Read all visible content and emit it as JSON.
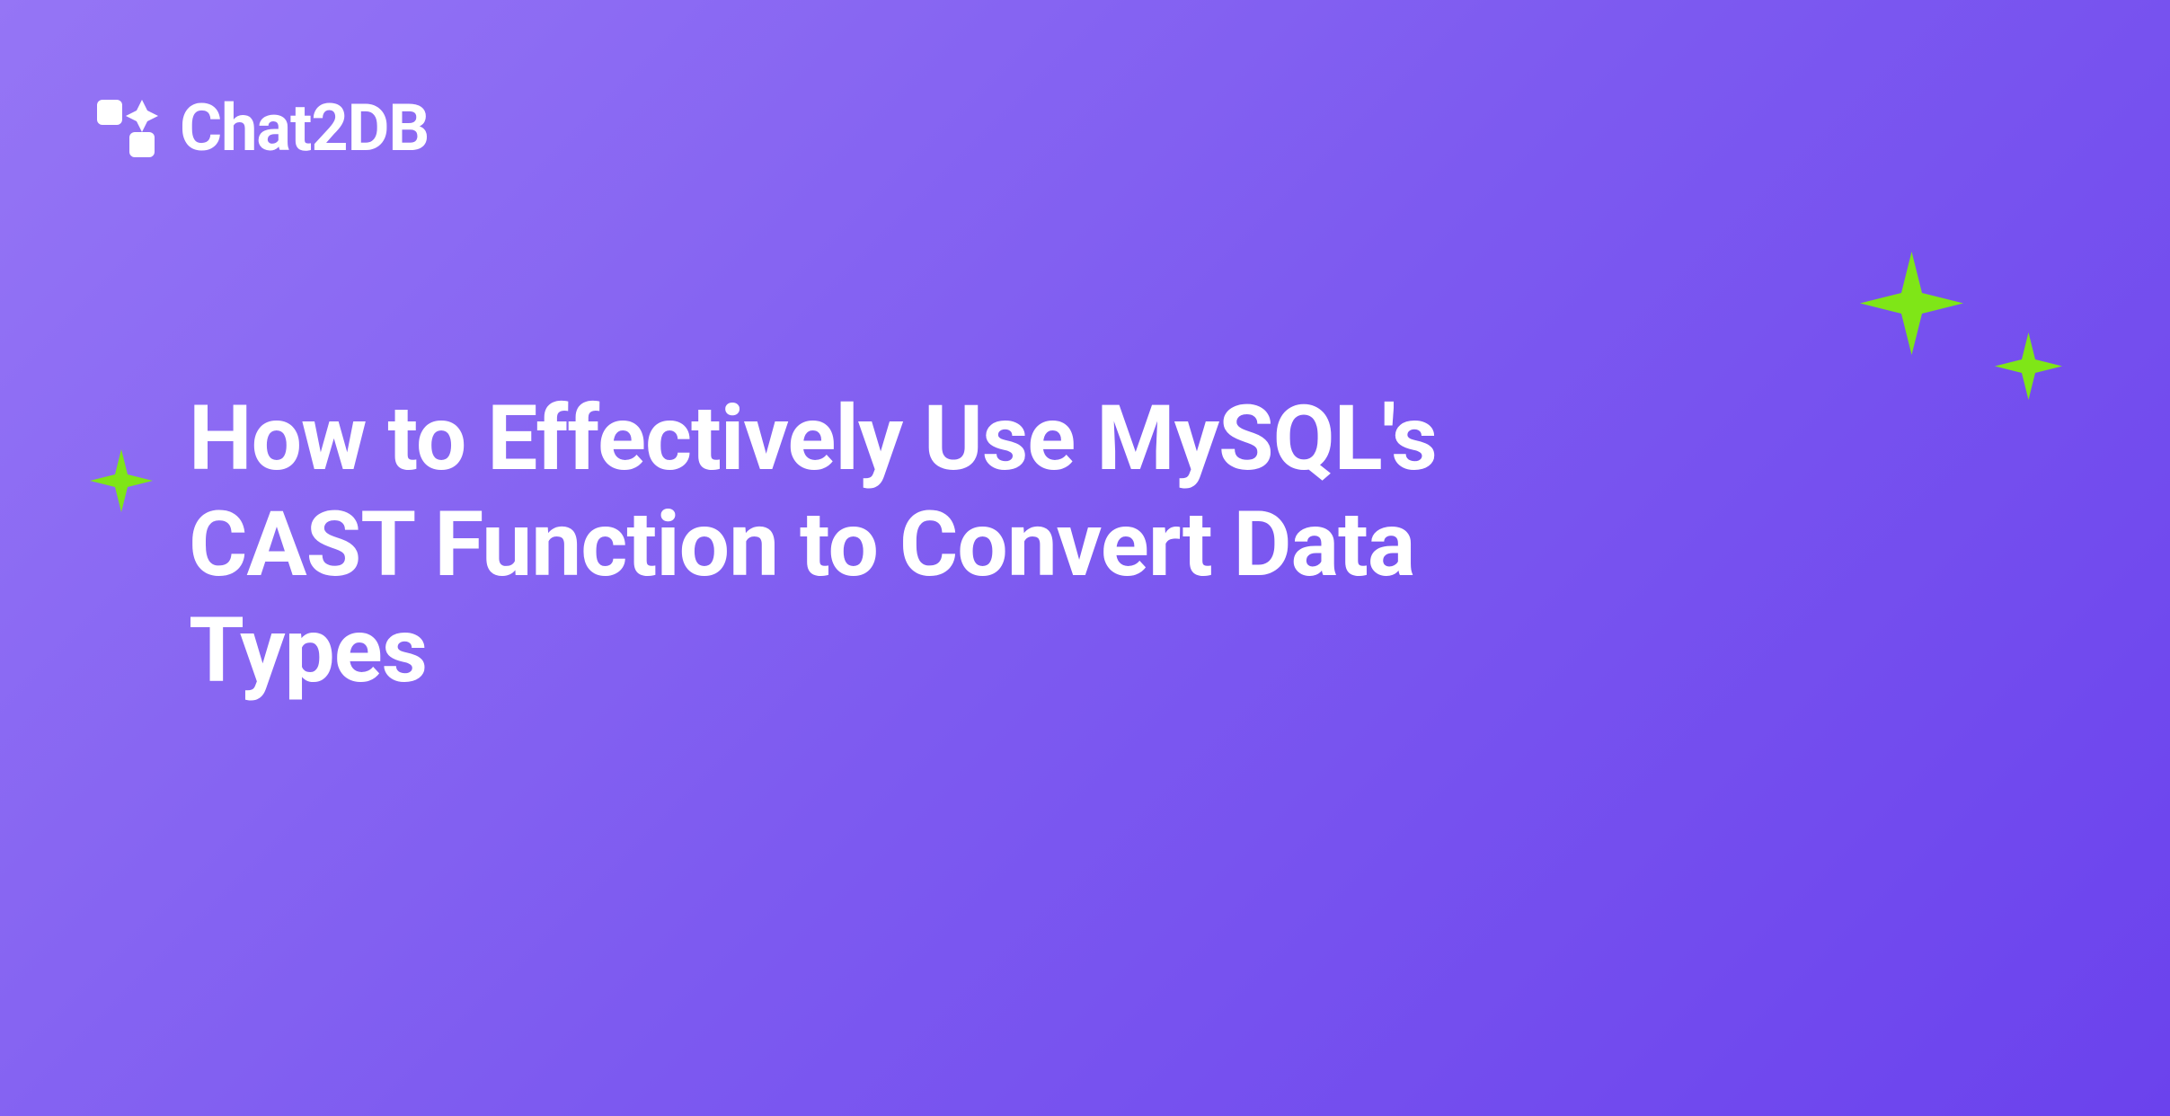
{
  "logo": {
    "text": "Chat2DB"
  },
  "title": "How to Effectively Use MySQL's CAST Function to Convert Data Types"
}
